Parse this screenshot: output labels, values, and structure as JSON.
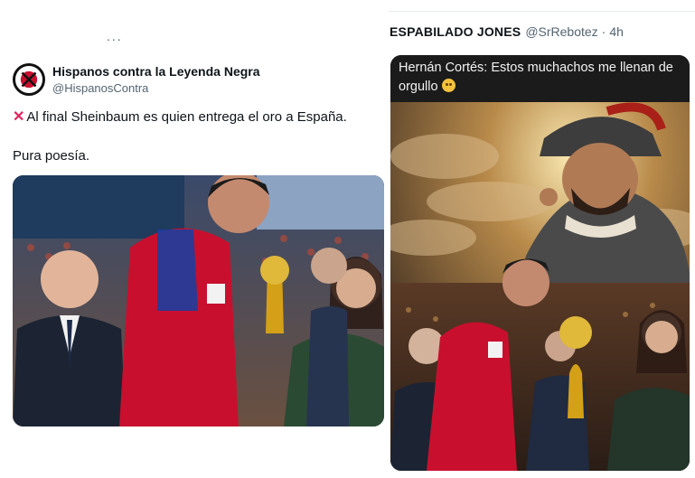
{
  "left_tweet": {
    "ellipsis": "...",
    "author": {
      "display_name": "Hispanos contra la Leyenda Negra",
      "handle": "@HispanosContra"
    },
    "text_line1": "Al final Sheinbaum es quien entrega el oro a España.",
    "text_line2": "Pura poesía.",
    "photo": {
      "icon": "award-ceremony-photo"
    }
  },
  "right_tweet": {
    "author": {
      "display_name": "ESPABILADO JONES",
      "handle": "@SrRebotez",
      "separator": "·",
      "time": "4h"
    },
    "meme": {
      "caption": "Hernán Cortés: Estos muchachos me llenan de orgullo",
      "caption_emoji": "smiling-face-emoji",
      "icon": "conquistador-meme-image"
    }
  },
  "colors": {
    "text_primary": "#0f1419",
    "text_secondary": "#536471",
    "x_mark": "#e0245e",
    "jersey_red": "#c8102e",
    "trophy_gold": "#d4a017"
  }
}
